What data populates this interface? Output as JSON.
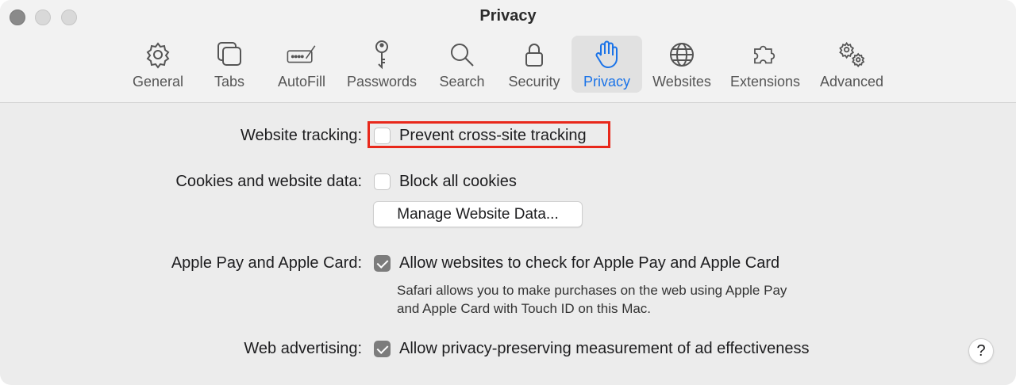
{
  "window": {
    "title": "Privacy",
    "traffic_lights": [
      "close",
      "minimize",
      "zoom"
    ]
  },
  "toolbar": [
    {
      "label": "General",
      "icon": "gear-icon",
      "active": false
    },
    {
      "label": "Tabs",
      "icon": "tabs-icon",
      "active": false
    },
    {
      "label": "AutoFill",
      "icon": "autofill-icon",
      "active": false
    },
    {
      "label": "Passwords",
      "icon": "key-icon",
      "active": false
    },
    {
      "label": "Search",
      "icon": "magnifier-icon",
      "active": false
    },
    {
      "label": "Security",
      "icon": "lock-icon",
      "active": false
    },
    {
      "label": "Privacy",
      "icon": "hand-icon",
      "active": true
    },
    {
      "label": "Websites",
      "icon": "globe-icon",
      "active": false
    },
    {
      "label": "Extensions",
      "icon": "puzzle-icon",
      "active": false
    },
    {
      "label": "Advanced",
      "icon": "gears-icon",
      "active": false
    }
  ],
  "settings": {
    "tracking": {
      "label": "Website tracking:",
      "option": "Prevent cross-site tracking",
      "checked": false
    },
    "cookies": {
      "label": "Cookies and website data:",
      "option": "Block all cookies",
      "checked": false,
      "button": "Manage Website Data..."
    },
    "applepay": {
      "label": "Apple Pay and Apple Card:",
      "option": "Allow websites to check for Apple Pay and Apple Card",
      "checked": true,
      "desc_line1": "Safari allows you to make purchases on the web using Apple Pay",
      "desc_line2": "and Apple Card with Touch ID on this Mac."
    },
    "advertising": {
      "label": "Web advertising:",
      "option": "Allow privacy-preserving measurement of ad effectiveness",
      "checked": true
    }
  },
  "help_label": "?",
  "colors": {
    "accent": "#1a73e8",
    "highlight_border": "#e8281b",
    "checkbox_checked": "#7c7c7c"
  }
}
